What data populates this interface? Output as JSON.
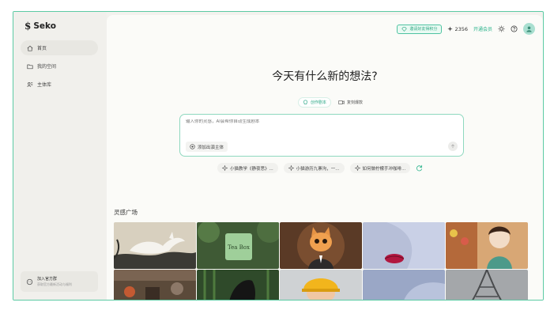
{
  "app": {
    "logo_text": "Seko"
  },
  "sidebar": {
    "items": [
      {
        "label": "首页",
        "icon": "home-icon",
        "active": true
      },
      {
        "label": "我的空间",
        "icon": "folder-icon",
        "active": false
      },
      {
        "label": "主体库",
        "icon": "people-icon",
        "active": false
      }
    ],
    "join": {
      "title": "加入官方群",
      "subtitle": "获取官方最新活动与福利"
    }
  },
  "topbar": {
    "invite_label": "邀请好友得积分",
    "credits": "2356",
    "member_label": "开通会员"
  },
  "hero": {
    "title": "今天有什么新的想法?"
  },
  "modes": [
    {
      "label": "创作剧本",
      "icon": "bulb-icon",
      "active": true
    },
    {
      "label": "复刻爆款",
      "icon": "video-icon",
      "active": false
    }
  ],
  "prompt": {
    "placeholder": "输入你的灵感，AI会帮你自动生成剧本",
    "add_subject_label": "添加出演主体"
  },
  "suggestions": [
    {
      "label": "小猫教学《静夜思》..."
    },
    {
      "label": "小猫游历九寨沟，一..."
    },
    {
      "label": "如何做柠檬手冲咖啡..."
    }
  ],
  "gallery": {
    "title": "灵感广场",
    "tiles": [
      {
        "subject": "white-fox-ink-painting"
      },
      {
        "subject": "tea-box-in-forest",
        "caption": "Tea Box"
      },
      {
        "subject": "orange-kitten-in-suit"
      },
      {
        "subject": "glitter-lips-portrait"
      },
      {
        "subject": "cartoon-girl-in-shop"
      },
      {
        "subject": "kitchen-interior"
      },
      {
        "subject": "bamboo-forest-figure"
      },
      {
        "subject": "child-in-hard-hat"
      },
      {
        "subject": "blue-portrait"
      },
      {
        "subject": "eiffel-tower"
      }
    ]
  },
  "colors": {
    "accent": "#2bb48c",
    "accent_border": "#5ccaa4",
    "background": "#f3f2ee"
  }
}
